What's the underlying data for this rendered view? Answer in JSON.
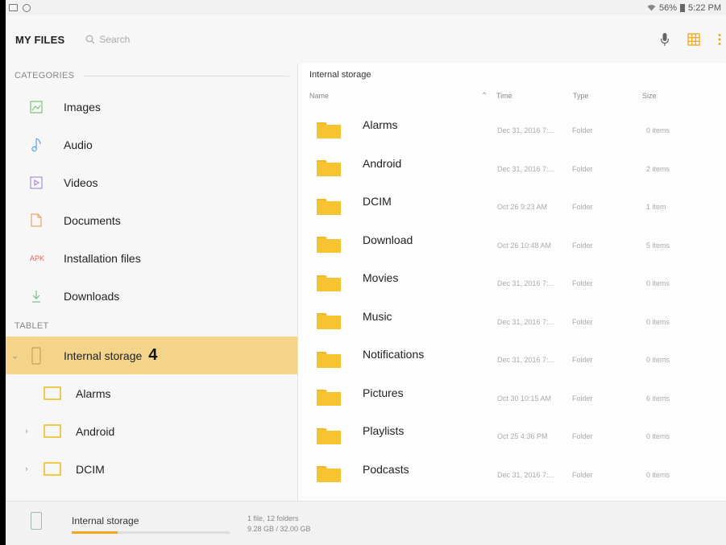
{
  "status_bar": {
    "battery": "56%",
    "time": "5:22 PM"
  },
  "toolbar": {
    "title": "MY FILES",
    "search_placeholder": "Search"
  },
  "sidebar": {
    "categories_header": "CATEGORIES",
    "categories": [
      {
        "label": "Images",
        "icon": "image-icon"
      },
      {
        "label": "Audio",
        "icon": "music-note-icon"
      },
      {
        "label": "Videos",
        "icon": "video-icon"
      },
      {
        "label": "Documents",
        "icon": "document-icon"
      },
      {
        "label": "Installation files",
        "icon": "apk-icon",
        "icon_text": "APK"
      },
      {
        "label": "Downloads",
        "icon": "download-icon"
      }
    ],
    "tablet_header": "TABLET",
    "storage_label": "Internal storage",
    "overlay_number": "4",
    "tree": [
      {
        "label": "Alarms"
      },
      {
        "label": "Android"
      },
      {
        "label": "DCIM"
      }
    ]
  },
  "file_list": {
    "location": "Internal storage",
    "columns": {
      "name": "Name",
      "time": "Time",
      "type": "Type",
      "size": "Size"
    },
    "rows": [
      {
        "name": "Alarms",
        "time": "Dec 31, 2016 7:...",
        "type": "Folder",
        "size": "0 items"
      },
      {
        "name": "Android",
        "time": "Dec 31, 2016 7:...",
        "type": "Folder",
        "size": "2 items"
      },
      {
        "name": "DCIM",
        "time": "Oct 26 9:23 AM",
        "type": "Folder",
        "size": "1 item"
      },
      {
        "name": "Download",
        "time": "Oct 26 10:48 AM",
        "type": "Folder",
        "size": "5 items"
      },
      {
        "name": "Movies",
        "time": "Dec 31, 2016 7:...",
        "type": "Folder",
        "size": "0 items"
      },
      {
        "name": "Music",
        "time": "Dec 31, 2016 7:...",
        "type": "Folder",
        "size": "0 items"
      },
      {
        "name": "Notifications",
        "time": "Dec 31, 2016 7:...",
        "type": "Folder",
        "size": "0 items"
      },
      {
        "name": "Pictures",
        "time": "Oct 30 10:15 AM",
        "type": "Folder",
        "size": "6 items"
      },
      {
        "name": "Playlists",
        "time": "Oct 25 4:36 PM",
        "type": "Folder",
        "size": "0 items"
      },
      {
        "name": "Podcasts",
        "time": "Dec 31, 2016 7:...",
        "type": "Folder",
        "size": "0 items"
      }
    ]
  },
  "footer": {
    "storage_name": "Internal storage",
    "summary": "1 file, 12 folders",
    "usage": "9.28 GB / 32.00 GB",
    "usage_fraction": 0.29
  },
  "colors": {
    "accent": "#f2a71b",
    "selected_bg": "#f4d489",
    "folder": "#f6c331"
  }
}
